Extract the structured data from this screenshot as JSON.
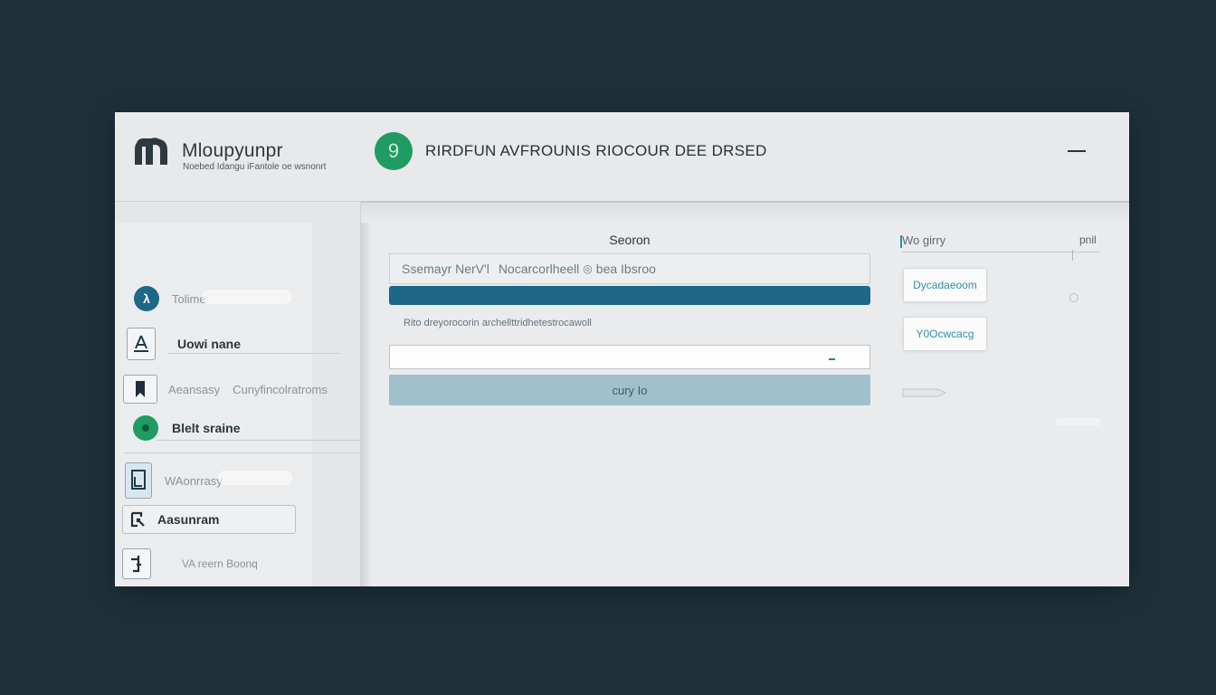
{
  "sidebar": {
    "brand_title": "Mloupyunpr",
    "brand_subtitle": "Noebed Idangu iFantole oe wsnonrt",
    "items": [
      {
        "label": "Tolime",
        "icon": "lambda-icon"
      },
      {
        "label": "Uowi nane",
        "icon": "person-icon"
      },
      {
        "label": "Aeansasy",
        "secondary": "Cunyfincolratroms",
        "icon": "bookmark-icon"
      },
      {
        "label": "Blelt sraine",
        "icon": "green-dot-icon"
      },
      {
        "label": "WAonrrasy",
        "icon": "document-icon"
      },
      {
        "label": "Aasunram",
        "icon": "tool-icon"
      },
      {
        "label": "VA reern Boonq",
        "icon": "box-icon"
      }
    ]
  },
  "header": {
    "logo_glyph": "9",
    "title": "RIRDFUN  AVFROUNIS  RIOCOUR  DEE DRSED"
  },
  "main": {
    "section_heading": "Seoron",
    "search_text_left": "Ssemayr  NerV'l",
    "search_text_right": "Nocarcorlheell",
    "search_text_tail": "bea Ibsroo",
    "hint": "Rito dreyorocorin archellttridhetestrocawoll",
    "apply_label": "cury Io",
    "side_label": "Wo girry",
    "side_aux": "pnil",
    "chips": [
      "Dycadaeoom",
      "Y0Ocwcacg"
    ]
  },
  "colors": {
    "background": "#1e313b",
    "accent_blue": "#1c6886",
    "accent_green": "#1f9b63",
    "button_light": "#9fc0cc"
  }
}
